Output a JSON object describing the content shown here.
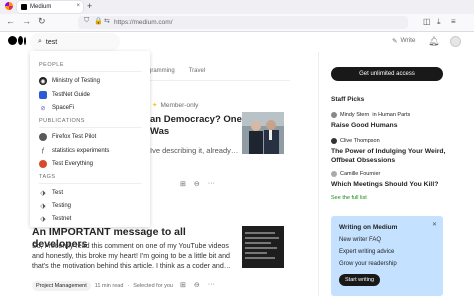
{
  "browser": {
    "tab_title": "Medium",
    "tab_close": "×",
    "new_tab": "+",
    "url": "https://medium.com/"
  },
  "header": {
    "search_value": "test",
    "write_label": "Write"
  },
  "topics": [
    "gramming",
    "Travel"
  ],
  "search_dropdown": {
    "people_header": "PEOPLE",
    "people": [
      "Ministry of Testing",
      "TestNet Guide",
      "SpaceFi"
    ],
    "publications_header": "PUBLICATIONS",
    "publications": [
      "Firefox Test Pilot",
      "statistics experiments",
      "Test Everything"
    ],
    "tags_header": "TAGS",
    "tags": [
      "Test",
      "Testing",
      "Testnet"
    ]
  },
  "article1": {
    "member_only": "Member-only",
    "title": "an Democracy? One Was",
    "body": "Ive describing it, already…"
  },
  "article2": {
    "title": "An IMPORTANT message to all developers",
    "body": "So, I recently read this comment on one of my YouTube videos and honestly, this broke my heart! I'm going to be a little bit and that's the motivation behind this article. I think as a coder and…",
    "tag": "Project Management",
    "read_time": "11 min read",
    "selected": "Selected for you"
  },
  "sidebar": {
    "cta_label": "Get unlimited access",
    "staff_picks_title": "Staff Picks",
    "picks": [
      {
        "author": "Mindy Stern",
        "publication": "in Human Parts",
        "title": "Raise Good Humans"
      },
      {
        "author": "Clive Thompson",
        "publication": "",
        "title": "The Power of Indulging Your Weird, Offbeat Obsessions"
      },
      {
        "author": "Camille Fournier",
        "publication": "",
        "title": "Which Meetings Should You Kill?"
      }
    ],
    "full_list": "See the full list",
    "writing": {
      "title": "Writing on Medium",
      "links": [
        "New writer FAQ",
        "Expert writing advice",
        "Grow your readership"
      ],
      "button": "Start writing"
    }
  },
  "colors": {
    "accent_green": "#1a8917",
    "writing_box": "#c4e2ff",
    "star": "#ffc017"
  }
}
